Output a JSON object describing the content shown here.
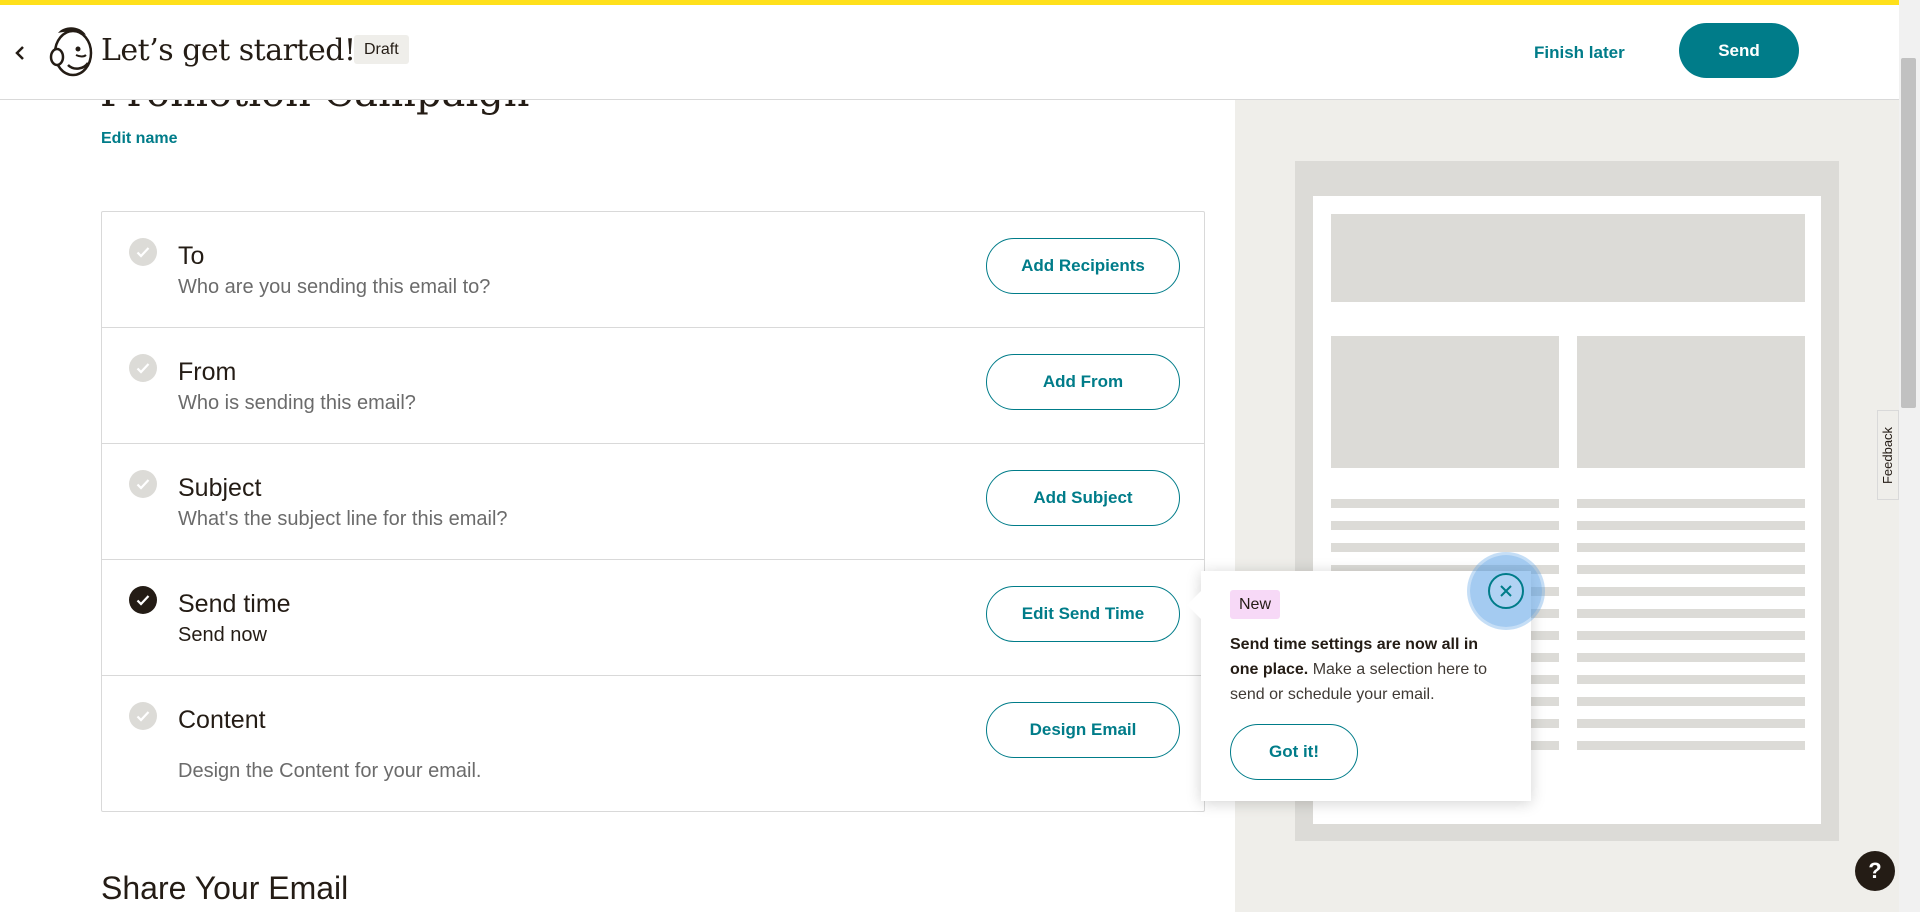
{
  "header": {
    "title": "Let’s get started!",
    "status_badge": "Draft",
    "finish_later_label": "Finish later",
    "send_label": "Send"
  },
  "campaign": {
    "name": "Promotion Campaign",
    "edit_name_label": "Edit name"
  },
  "checklist": [
    {
      "title": "To",
      "subtitle": "Who are you sending this email to?",
      "button": "Add Recipients",
      "complete": false
    },
    {
      "title": "From",
      "subtitle": "Who is sending this email?",
      "button": "Add From",
      "complete": false
    },
    {
      "title": "Subject",
      "subtitle": "What's the subject line for this email?",
      "button": "Add Subject",
      "complete": false
    },
    {
      "title": "Send time",
      "subtitle": "Send now",
      "button": "Edit Send Time",
      "complete": true
    },
    {
      "title": "Content",
      "subtitle": "Design the Content for your email.",
      "button": "Design Email",
      "complete": false
    }
  ],
  "share": {
    "title": "Share Your Email"
  },
  "popover": {
    "badge": "New",
    "bold_text": "Send time settings are now all in one place.",
    "body_text": " Make a selection here to send or schedule your email.",
    "button_label": "Got it!"
  },
  "feedback_label": "Feedback",
  "help_label": "?",
  "colors": {
    "accent": "#007c89",
    "top_stripe": "#ffe01b",
    "new_badge": "#f7d9f7",
    "preview_bg": "#efeeea"
  },
  "icons": [
    "back-chevron-icon",
    "mailchimp-logo",
    "check-icon",
    "close-icon",
    "help-icon"
  ]
}
